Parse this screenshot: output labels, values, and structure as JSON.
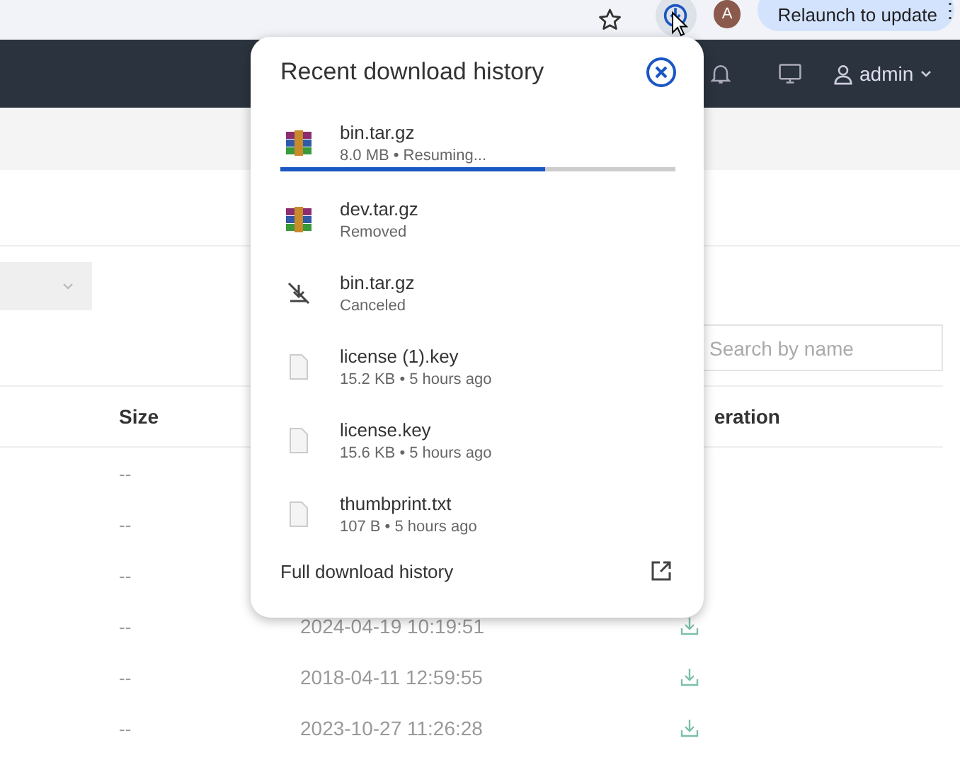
{
  "browser": {
    "avatar_initial": "A",
    "relaunch_label": "Relaunch to update",
    "menu_glyph": "⋮"
  },
  "header": {
    "user": "admin"
  },
  "toolbar": {
    "search": {
      "placeholder": "Search by name"
    }
  },
  "table": {
    "columns": [
      {
        "label": "Size"
      },
      {
        "label": "eration"
      }
    ],
    "rows": [
      {
        "size": "--"
      },
      {
        "size": "--"
      },
      {
        "size": "--"
      },
      {
        "size": "--",
        "date": "2024-04-19 10:19:51"
      },
      {
        "size": "--",
        "date": "2018-04-11 12:59:55"
      },
      {
        "size": "--",
        "date": "2023-10-27 11:26:28"
      }
    ]
  },
  "download_popup": {
    "title": "Recent download history",
    "items": [
      {
        "kind": "archive",
        "name": "bin.tar.gz",
        "detail": "8.0 MB • Resuming...",
        "level": 0.67
      },
      {
        "kind": "archive",
        "name": "dev.tar.gz",
        "detail": "Removed"
      },
      {
        "kind": "canceled",
        "name": "bin.tar.gz",
        "detail": "Canceled"
      },
      {
        "kind": "file",
        "name": "license (1).key",
        "detail": "15.2 KB • 5 hours ago"
      },
      {
        "kind": "file",
        "name": "license.key",
        "detail": "15.6 KB • 5 hours ago"
      },
      {
        "kind": "file",
        "name": "thumbprint.txt",
        "detail": "107 B • 5 hours ago"
      }
    ],
    "footer_link": "Full download history"
  }
}
